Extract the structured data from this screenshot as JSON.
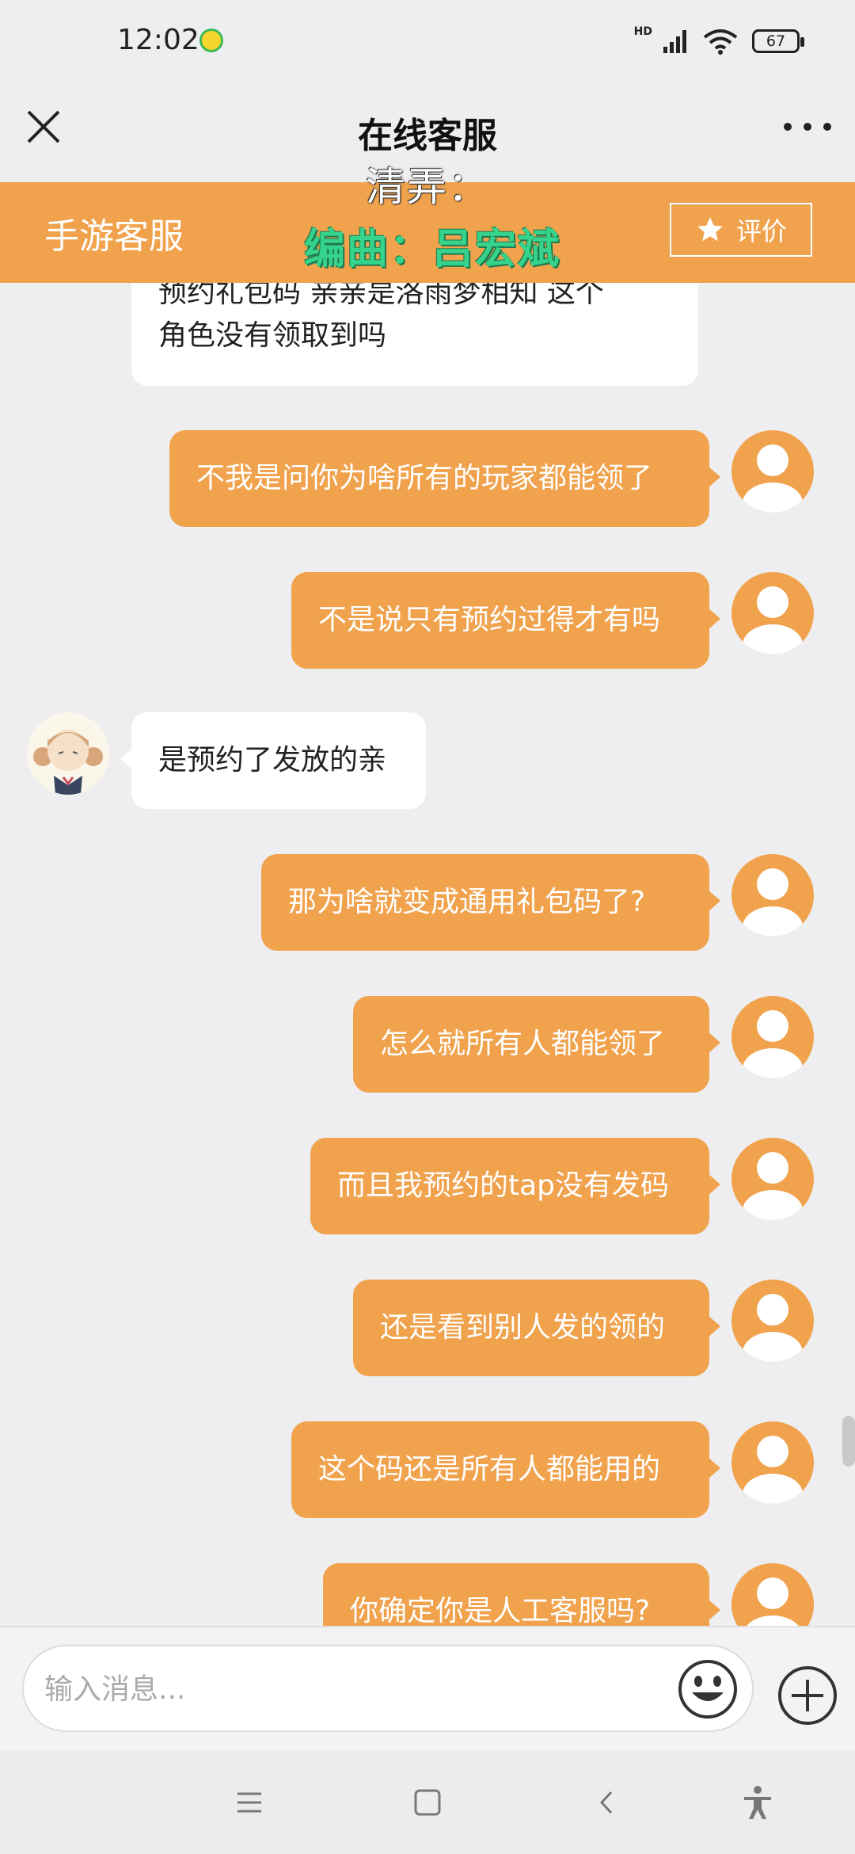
{
  "status_bar": {
    "time": "12:02",
    "hd": "HD",
    "battery": "67"
  },
  "titlebar": {
    "title": "在线客服"
  },
  "header": {
    "service_name": "手游客服",
    "rate_label": "评价"
  },
  "overlay": {
    "line1": "清弄：",
    "line2": "编曲：吕宏斌"
  },
  "messages": [
    {
      "from": "agent",
      "line1": "预约礼包码 亲亲是洛雨梦相知 这个",
      "line2": "角色没有领取到吗"
    },
    {
      "from": "user",
      "text": "不我是问你为啥所有的玩家都能领了"
    },
    {
      "from": "user",
      "text": "不是说只有预约过得才有吗"
    },
    {
      "from": "agent",
      "text": "是预约了发放的亲"
    },
    {
      "from": "user",
      "text": "那为啥就变成通用礼包码了?"
    },
    {
      "from": "user",
      "text": "怎么就所有人都能领了"
    },
    {
      "from": "user",
      "text": "而且我预约的tap没有发码"
    },
    {
      "from": "user",
      "text": "还是看到别人发的领的"
    },
    {
      "from": "user",
      "text": "这个码还是所有人都能用的"
    },
    {
      "from": "user",
      "text": "你确定你是人工客服吗?"
    }
  ],
  "input": {
    "placeholder": "输入消息..."
  },
  "colors": {
    "accent": "#f0a24d",
    "overlay_green": "#35d38b"
  }
}
